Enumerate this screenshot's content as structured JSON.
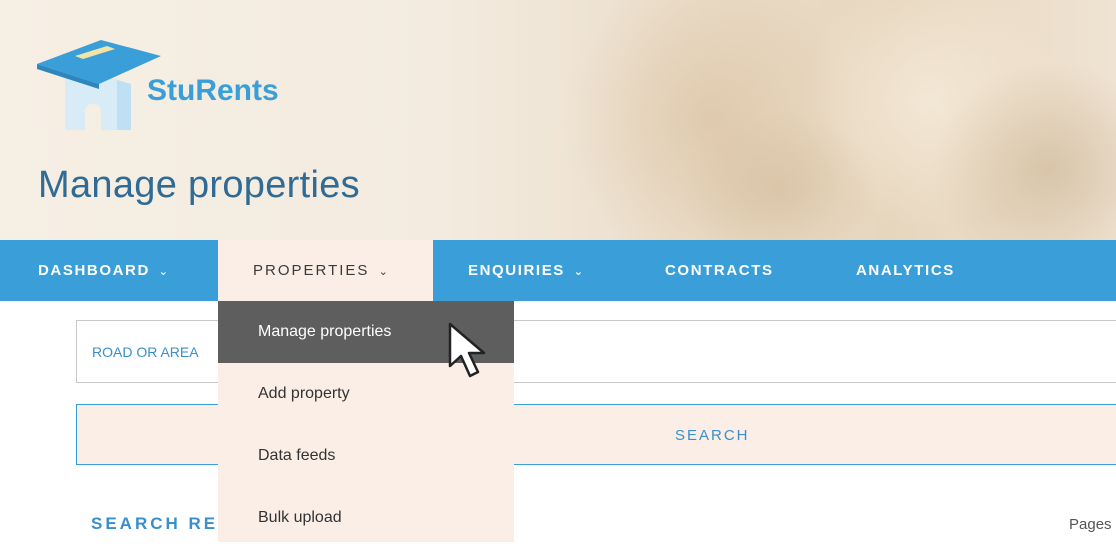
{
  "brand": {
    "name": "StuRents"
  },
  "page": {
    "title": "Manage properties"
  },
  "nav": {
    "items": [
      {
        "label": "DASHBOARD",
        "chevron": "⌄"
      },
      {
        "label": "PROPERTIES",
        "chevron": "⌄"
      },
      {
        "label": "ENQUIRIES",
        "chevron": "⌄"
      },
      {
        "label": "CONTRACTS"
      },
      {
        "label": "ANALYTICS"
      }
    ]
  },
  "properties_menu": {
    "items": [
      {
        "label": "Manage properties"
      },
      {
        "label": "Add property"
      },
      {
        "label": "Data feeds"
      },
      {
        "label": "Bulk upload"
      }
    ]
  },
  "search": {
    "placeholder": "ROAD OR AREA",
    "button_label": "SEARCH"
  },
  "results": {
    "heading": "SEARCH RES",
    "pages_label": "Pages"
  },
  "colors": {
    "accent": "#3a9fd8",
    "title": "#2f6b94",
    "menu_bg": "#fbeee6",
    "menu_hover": "#5e5e5e"
  },
  "icons": {
    "logo": "graduation-cap-house-icon",
    "chevron": "chevron-down-icon",
    "cursor": "mouse-pointer-icon"
  }
}
